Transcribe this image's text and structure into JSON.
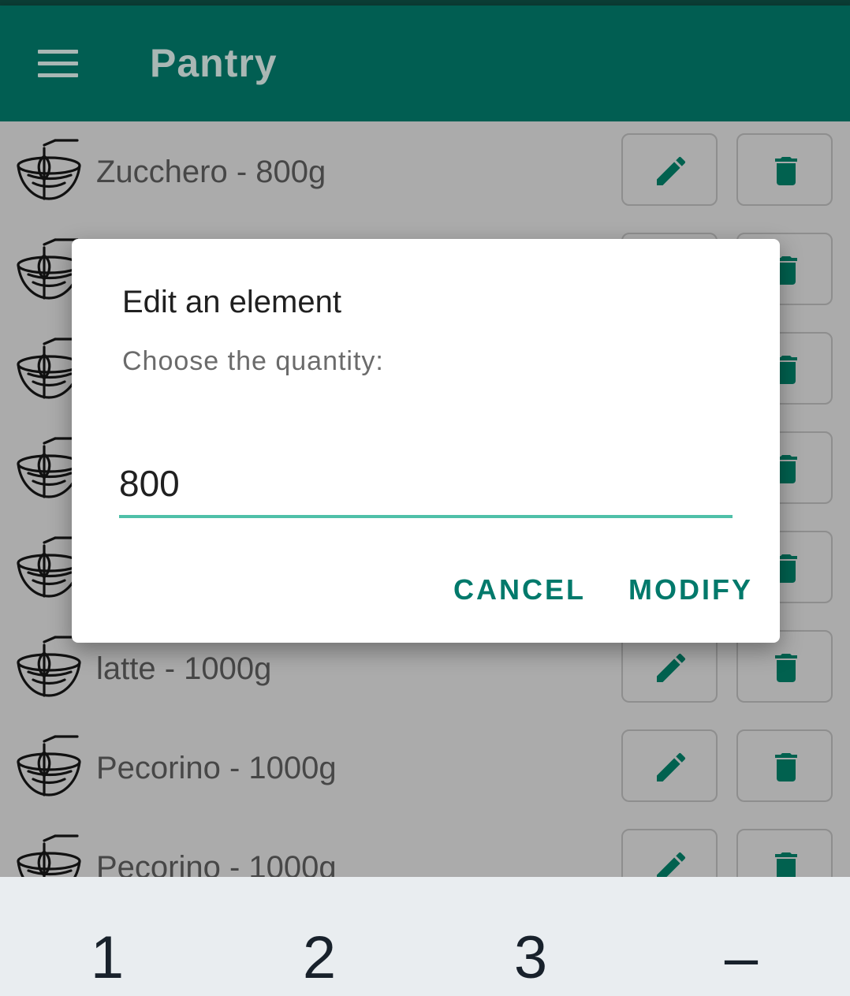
{
  "app": {
    "title": "Pantry",
    "accent": "#015e52"
  },
  "list": {
    "items": [
      {
        "label": "Zucchero - 800g"
      },
      {
        "label": ""
      },
      {
        "label": ""
      },
      {
        "label": ""
      },
      {
        "label": ""
      },
      {
        "label": "latte - 1000g"
      },
      {
        "label": "Pecorino - 1000g"
      },
      {
        "label": "Pecorino - 1000g"
      }
    ],
    "item_icon": "bowl-whisk-icon",
    "edit_icon": "pencil-icon",
    "delete_icon": "trash-icon"
  },
  "dialog": {
    "title": "Edit an element",
    "message": "Choose the quantity:",
    "input_value": "800",
    "cancel_label": "CANCEL",
    "modify_label": "MODIFY",
    "button_color": "#01796b",
    "underline_color": "#4fc0a8"
  },
  "keyboard": {
    "keys": [
      "1",
      "2",
      "3",
      "–"
    ]
  }
}
